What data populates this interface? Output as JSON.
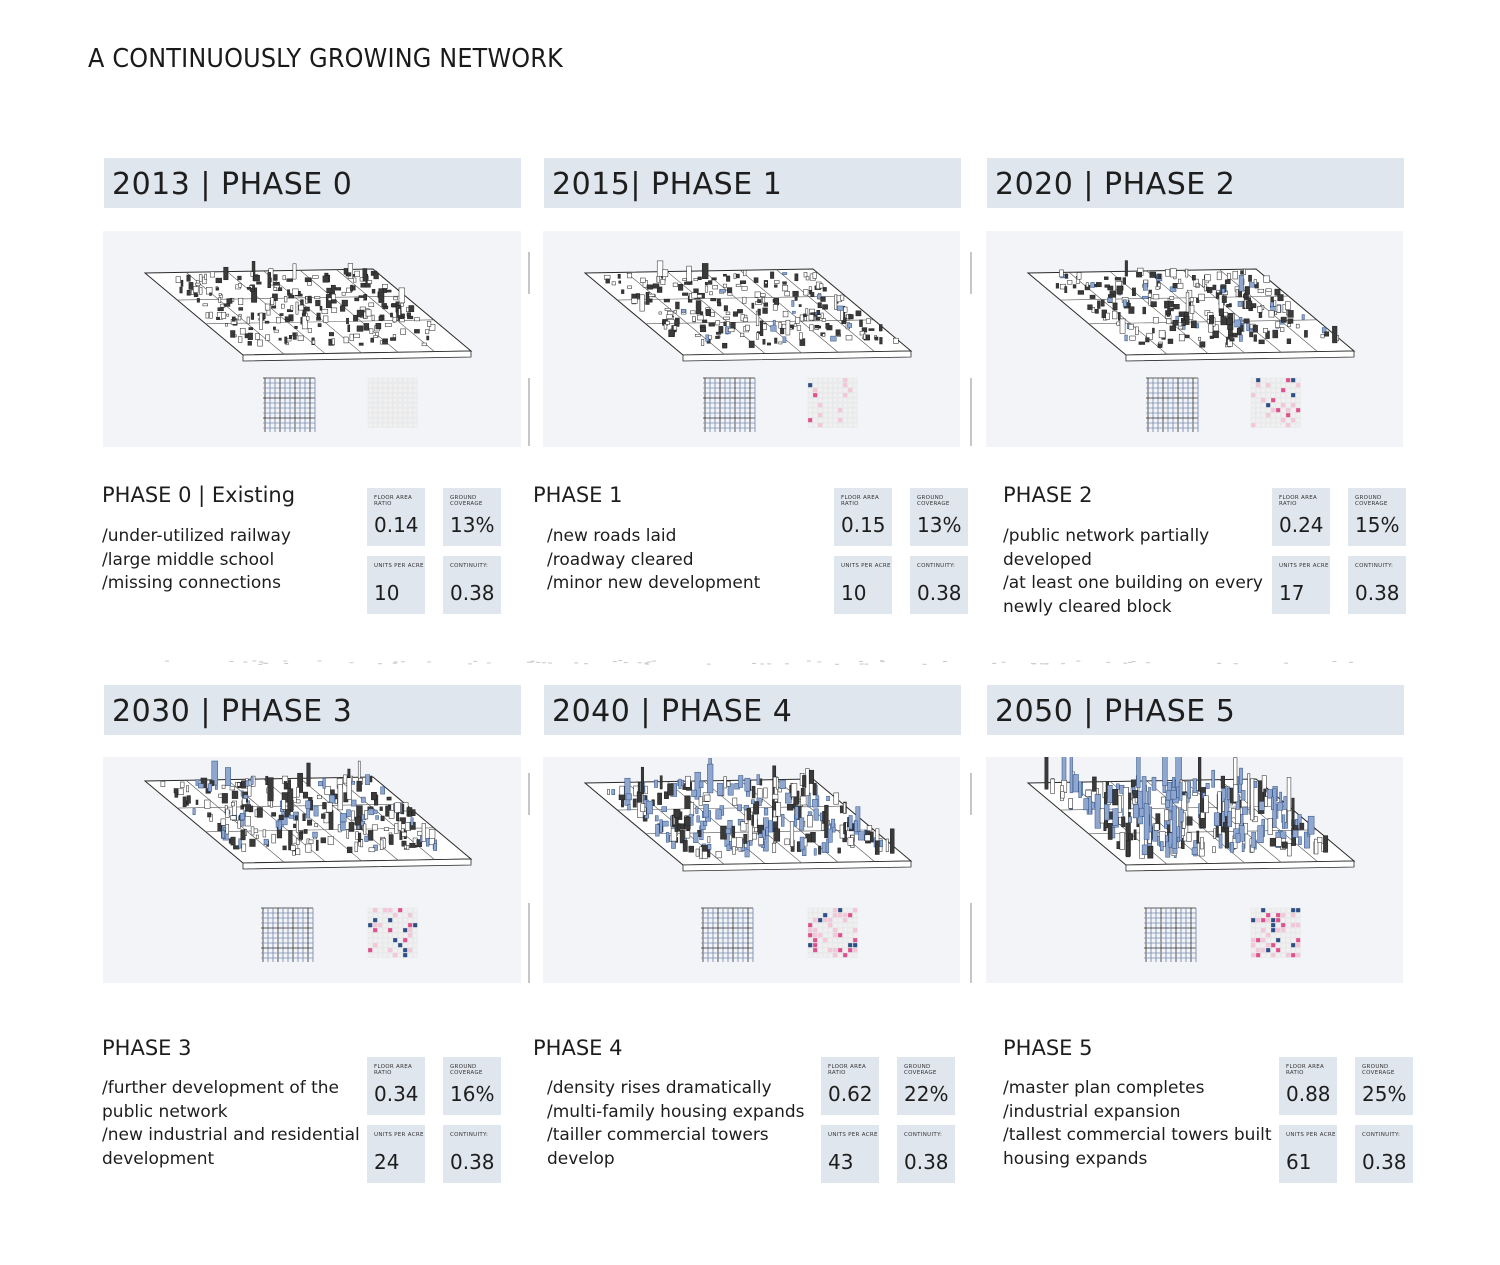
{
  "title": "A CONTINUOUSLY GROWING NETWORK",
  "colors": {
    "header_bg": "#e0e6ee",
    "panel_bg": "#f2f4f7",
    "accent_blue": "#2d4f86",
    "accent_pink": "#e0508c",
    "light_pink": "#f4c6d8"
  },
  "phases": [
    {
      "header": "2013 | PHASE 0",
      "title": "PHASE 0 | Existing",
      "desc": [
        "/under-utilized railway",
        "/large middle school",
        "/missing connections"
      ],
      "stats": [
        {
          "label": "FLOOR AREA RATIO",
          "value": "0.14"
        },
        {
          "label": "GROUND COVERAGE",
          "value": "13%"
        },
        {
          "label": "UNITS PER ACRE",
          "value": "10"
        },
        {
          "label": "CONTINUITY:",
          "value": "0.38"
        }
      ]
    },
    {
      "header": "2015| PHASE 1",
      "title": "PHASE 1",
      "desc": [
        "/new roads laid",
        "/roadway cleared",
        "/minor new development"
      ],
      "stats": [
        {
          "label": "FLOOR AREA RATIO",
          "value": "0.15"
        },
        {
          "label": "GROUND COVERAGE",
          "value": "13%"
        },
        {
          "label": "UNITS PER ACRE",
          "value": "10"
        },
        {
          "label": "CONTINUITY:",
          "value": "0.38"
        }
      ]
    },
    {
      "header": "2020 | PHASE 2",
      "title": "PHASE 2",
      "desc": [
        "/public network partially",
        "developed",
        "/at least one building on every",
        "newly cleared block"
      ],
      "stats": [
        {
          "label": "FLOOR AREA RATIO",
          "value": "0.24"
        },
        {
          "label": "GROUND COVERAGE",
          "value": "15%"
        },
        {
          "label": "UNITS PER ACRE",
          "value": "17"
        },
        {
          "label": "CONTINUITY:",
          "value": "0.38"
        }
      ]
    },
    {
      "header": "2030 | PHASE 3",
      "title": "PHASE 3",
      "desc": [
        "/further development of the",
        "public network",
        "/new industrial and residential",
        "development"
      ],
      "stats": [
        {
          "label": "FLOOR AREA RATIO",
          "value": "0.34"
        },
        {
          "label": "GROUND COVERAGE",
          "value": "16%"
        },
        {
          "label": "UNITS PER ACRE",
          "value": "24"
        },
        {
          "label": "CONTINUITY:",
          "value": "0.38"
        }
      ]
    },
    {
      "header": "2040 | PHASE 4",
      "title": "PHASE 4",
      "desc": [
        "/density rises dramatically",
        "/multi-family housing expands",
        "/tailler commercial towers",
        "develop"
      ],
      "stats": [
        {
          "label": "FLOOR AREA RATIO",
          "value": "0.62"
        },
        {
          "label": "GROUND COVERAGE",
          "value": "22%"
        },
        {
          "label": "UNITS PER ACRE",
          "value": "43"
        },
        {
          "label": "CONTINUITY:",
          "value": "0.38"
        }
      ]
    },
    {
      "header": "2050 | PHASE 5",
      "title": "PHASE 5",
      "desc": [
        "/master plan completes",
        "/industrial expansion",
        "/tallest commercial towers built",
        "housing expands"
      ],
      "stats": [
        {
          "label": "FLOOR AREA RATIO",
          "value": "0.88"
        },
        {
          "label": "GROUND COVERAGE",
          "value": "25%"
        },
        {
          "label": "UNITS PER ACRE",
          "value": "61"
        },
        {
          "label": "CONTINUITY:",
          "value": "0.38"
        }
      ]
    }
  ]
}
